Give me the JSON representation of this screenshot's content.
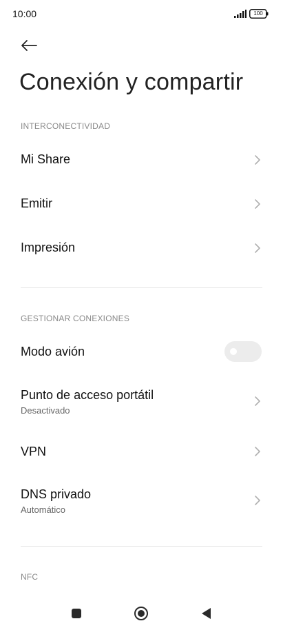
{
  "status_bar": {
    "time": "10:00",
    "battery_level": "100",
    "icons": [
      "signal-icon",
      "battery-icon"
    ]
  },
  "header": {
    "back_icon": "arrow-left-icon",
    "title": "Conexión y compartir"
  },
  "sections": [
    {
      "header": "INTERCONECTIVIDAD",
      "items": [
        {
          "title": "Mi Share",
          "type": "link"
        },
        {
          "title": "Emitir",
          "type": "link"
        },
        {
          "title": "Impresión",
          "type": "link"
        }
      ]
    },
    {
      "header": "GESTIONAR CONEXIONES",
      "items": [
        {
          "title": "Modo avión",
          "type": "toggle",
          "enabled": false
        },
        {
          "title": "Punto de acceso portátil",
          "subtitle": "Desactivado",
          "type": "link"
        },
        {
          "title": "VPN",
          "type": "link"
        },
        {
          "title": "DNS privado",
          "subtitle": "Automático",
          "type": "link"
        }
      ]
    },
    {
      "header": "NFC",
      "items": []
    }
  ],
  "nav_bar": {
    "icons": [
      "recents-square-icon",
      "home-circle-icon",
      "back-triangle-icon"
    ]
  },
  "colors": {
    "background": "#ffffff",
    "section_header": "#8a8a8a",
    "divider": "#e6e6e6",
    "toggle_off": "#ececec"
  }
}
